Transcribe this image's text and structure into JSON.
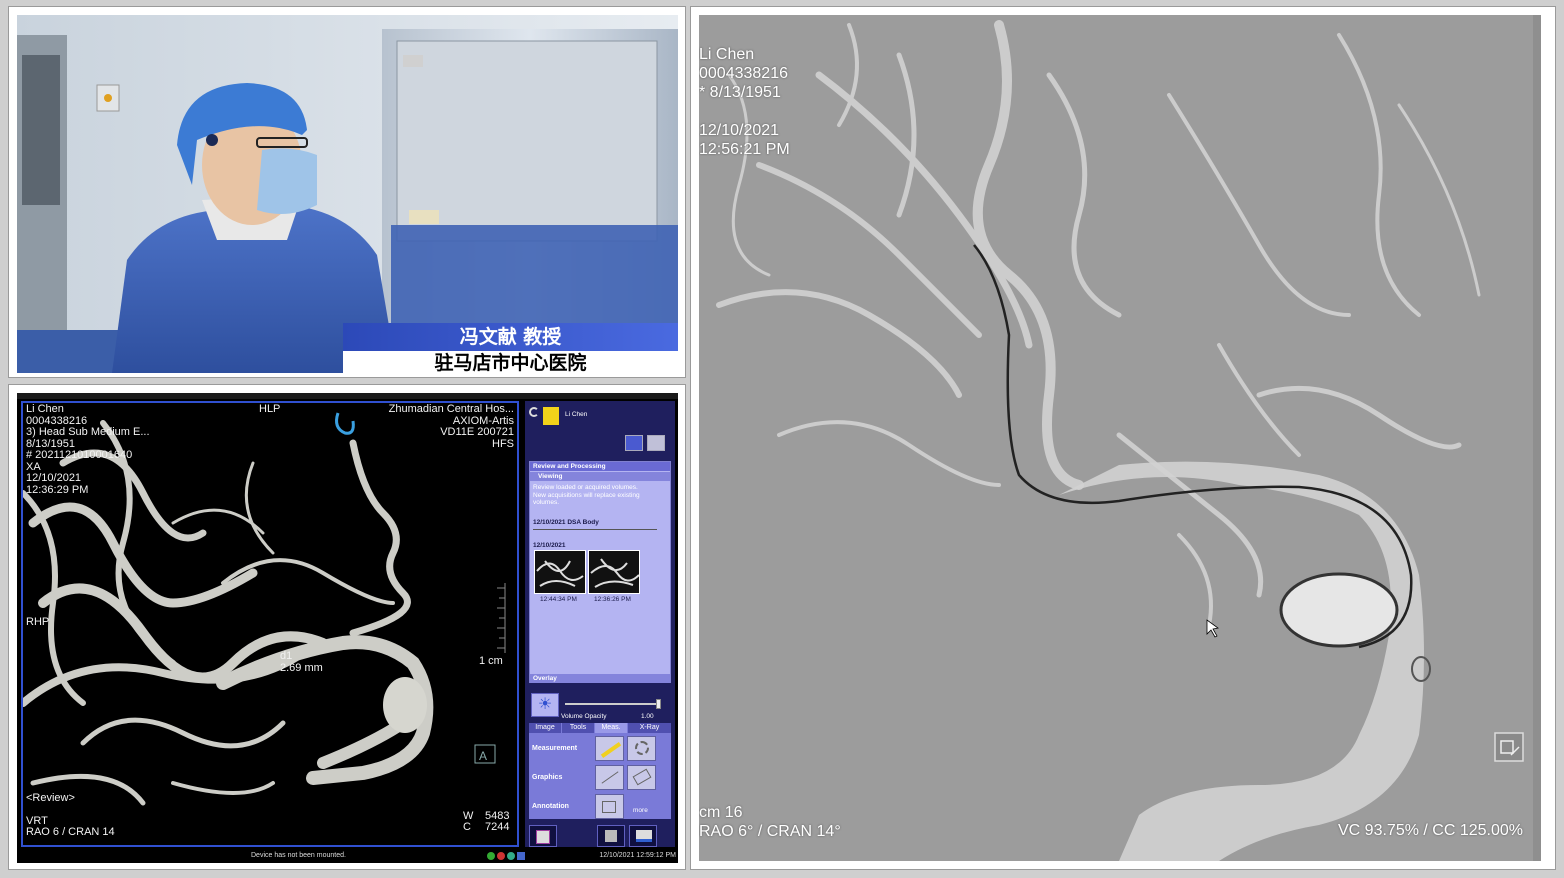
{
  "video": {
    "caption_name": "冯文献 教授",
    "caption_hospital": "驻马店市中心医院"
  },
  "workstation": {
    "overlay_top_left": "Li Chen\n0004338216\n3) Head Sub Medium E...\n8/13/1951\n# 2021121010001640\nXA\n12/10/2021\n12:36:29 PM",
    "overlay_top_center": "HLP",
    "overlay_top_right": "Zhumadian Central Hos...\nAXIOM-Artis\nVD11E 200721\nHFS",
    "orientation_left": "RHP",
    "scale_label": "1 cm",
    "measure_label": "d1\n2.69 mm",
    "review_label": "<Review>",
    "render_mode": "VRT",
    "angle": "RAO 6 / CRAN 14",
    "window_w_label": "W",
    "window_w_value": "5483",
    "window_c_label": "C",
    "window_c_value": "7244",
    "status_message": "Device has not been mounted.",
    "status_time": "12/10/2021 12:59:12 PM",
    "side": {
      "patient": "Li Chen",
      "section_title": "Review and Processing",
      "viewing_title": "Viewing",
      "viewing_help": "Review loaded or acquired volumes.\nNew acquisitions will replace existing\nvolumes.",
      "series_title": "12/10/2021 DSA Body",
      "series_date": "12/10/2021",
      "thumb1_time": "12:44:34 PM",
      "thumb2_time": "12:36:26 PM",
      "overlay_title": "Overlay",
      "opacity_label": "Volume Opacity",
      "opacity_value": "1.00",
      "opacity_fraction": 1.0,
      "tabs": [
        "Image",
        "Tools",
        "Meas.",
        "X-Ray"
      ],
      "measurement_label": "Measurement",
      "graphics_label": "Graphics",
      "annotation_label": "Annotation",
      "more_label": "more"
    }
  },
  "dsa": {
    "overlay_top_left": "Li Chen\n0004338216\n* 8/13/1951\n\n12/10/2021\n12:56:21 PM",
    "overlay_bottom_left": "cm 16\nRAO 6° / CRAN 14°",
    "overlay_bottom_right": "VC 93.75% / CC 125.00%"
  },
  "icons": [
    "camera-icon",
    "folder-icon",
    "layout-icon",
    "ruler-icon",
    "cursor-icon",
    "orientation-cube-icon",
    "sun-icon"
  ]
}
